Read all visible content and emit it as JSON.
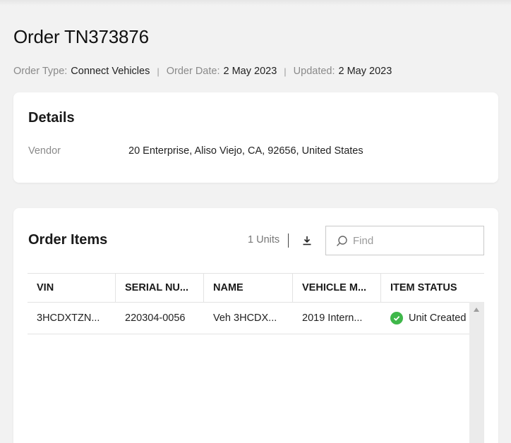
{
  "page": {
    "title": "Order TN373876"
  },
  "meta": {
    "order_type_label": "Order Type:",
    "order_type_value": "Connect Vehicles",
    "separator": "|",
    "order_date_label": "Order Date:",
    "order_date_value": "2 May 2023",
    "updated_label": "Updated:",
    "updated_value": "2 May 2023"
  },
  "details": {
    "heading": "Details",
    "vendor_label": "Vendor",
    "vendor_value": "20 Enterprise, Aliso Viejo, CA, 92656, United States"
  },
  "order_items": {
    "heading": "Order Items",
    "units": "1 Units",
    "download_icon": "download-icon",
    "find_placeholder": "Find",
    "find_value": "",
    "columns": [
      "VIN",
      "SERIAL NU...",
      "NAME",
      "VEHICLE M...",
      "ITEM STATUS"
    ],
    "rows": [
      {
        "vin": "3HCDXTZN...",
        "serial": "220304-0056",
        "name": "Veh 3HCDX...",
        "vehicle_model": "2019 Intern...",
        "status": "Unit Created",
        "status_icon": "check-circle-icon"
      }
    ]
  },
  "colors": {
    "background": "#f2f2f2",
    "card": "#ffffff",
    "status_success": "#3fb74a",
    "muted_text": "#8a8a8a"
  }
}
